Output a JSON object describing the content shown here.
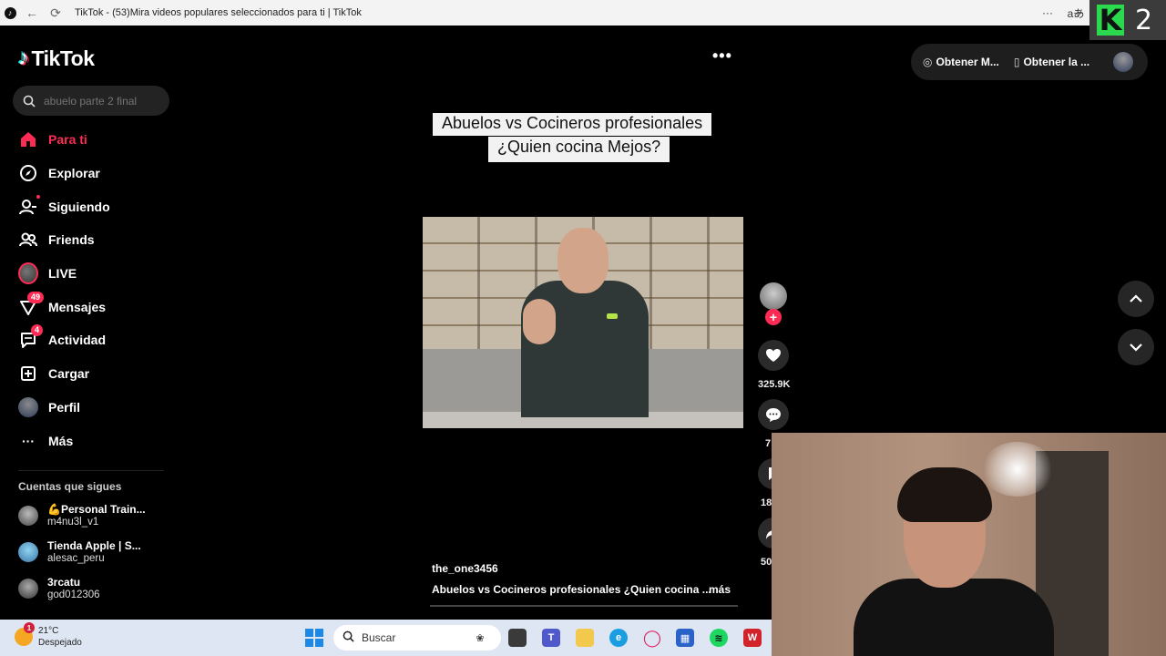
{
  "browser": {
    "title": "TikTok - (53)Mira videos populares seleccionados para ti | TikTok",
    "translate_label": "aあ",
    "menu_label": "···",
    "minimize_label": "—"
  },
  "overlay": {
    "logo_letter": "K",
    "number": "2"
  },
  "sidebar": {
    "logo_text": "TikTok",
    "search_placeholder": "abuelo parte 2 final",
    "nav": [
      {
        "label": "Para ti",
        "icon": "home-icon"
      },
      {
        "label": "Explorar",
        "icon": "compass-icon"
      },
      {
        "label": "Siguiendo",
        "icon": "following-icon"
      },
      {
        "label": "Friends",
        "icon": "friends-icon"
      },
      {
        "label": "LIVE",
        "icon": "live-avatar"
      },
      {
        "label": "Mensajes",
        "icon": "messages-icon",
        "badge": "49"
      },
      {
        "label": "Actividad",
        "icon": "activity-icon",
        "badge": "4"
      },
      {
        "label": "Cargar",
        "icon": "upload-icon"
      },
      {
        "label": "Perfil",
        "icon": "profile-avatar"
      },
      {
        "label": "Más",
        "icon": "more-icon"
      }
    ],
    "following_title": "Cuentas que sigues",
    "accounts": [
      {
        "name": "💪Personal Train...",
        "user": "m4nu3l_v1"
      },
      {
        "name": "Tienda Apple | S...",
        "user": "alesac_peru"
      },
      {
        "name": "3rcatu",
        "user": "god012306"
      }
    ]
  },
  "topbar": {
    "pill1": "Obtener M...",
    "pill2": "Obtener la ..."
  },
  "video": {
    "caption_line1": "Abuelos vs Cocineros profesionales",
    "caption_line2": "¿Quien cocina Mejos?",
    "username": "the_one3456",
    "description": "Abuelos vs Cocineros profesionales  ¿Quien cocina ...",
    "more_label": "más",
    "likes": "325.9K",
    "comments": "7",
    "saves": "18",
    "shares": "50"
  },
  "taskbar": {
    "temperature": "21°C",
    "weather": "Despejado",
    "weather_badge": "1",
    "search_placeholder": "Buscar"
  }
}
